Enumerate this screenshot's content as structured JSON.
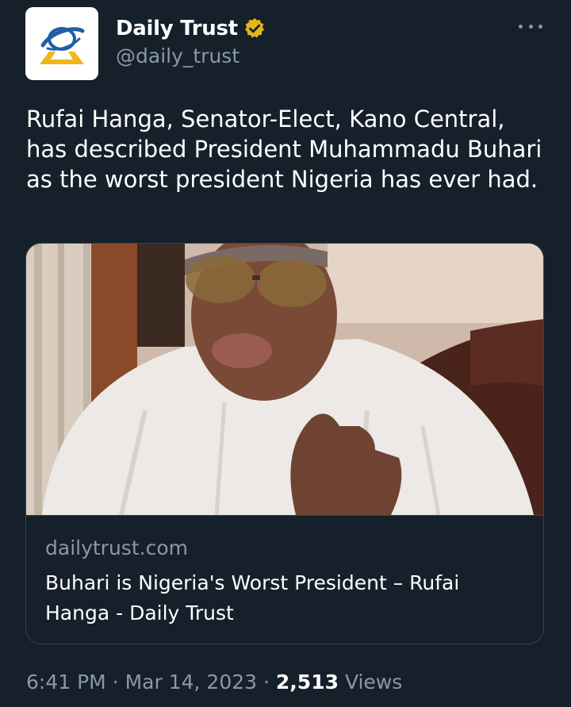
{
  "account": {
    "display_name": "Daily Trust",
    "handle": "@daily_trust",
    "verified_color": "#e2b719",
    "avatar_icon": "daily-trust-logo"
  },
  "menu": {
    "icon": "more-horizontal-icon"
  },
  "tweet": {
    "text": "Rufai Hanga, Senator-Elect, Kano Central, has described President Muhammadu Buhari as the worst president Nigeria has ever had."
  },
  "card": {
    "domain": "dailytrust.com",
    "title": "Buhari is Nigeria's Worst President – Rufai Hanga - Daily Trust"
  },
  "meta": {
    "time": "6:41 PM",
    "separator": "·",
    "date": "Mar 14, 2023",
    "views_count": "2,513",
    "views_label": "Views"
  },
  "theme": {
    "background": "#15202b",
    "secondary_text": "#8b98a5",
    "border": "#38444d"
  }
}
